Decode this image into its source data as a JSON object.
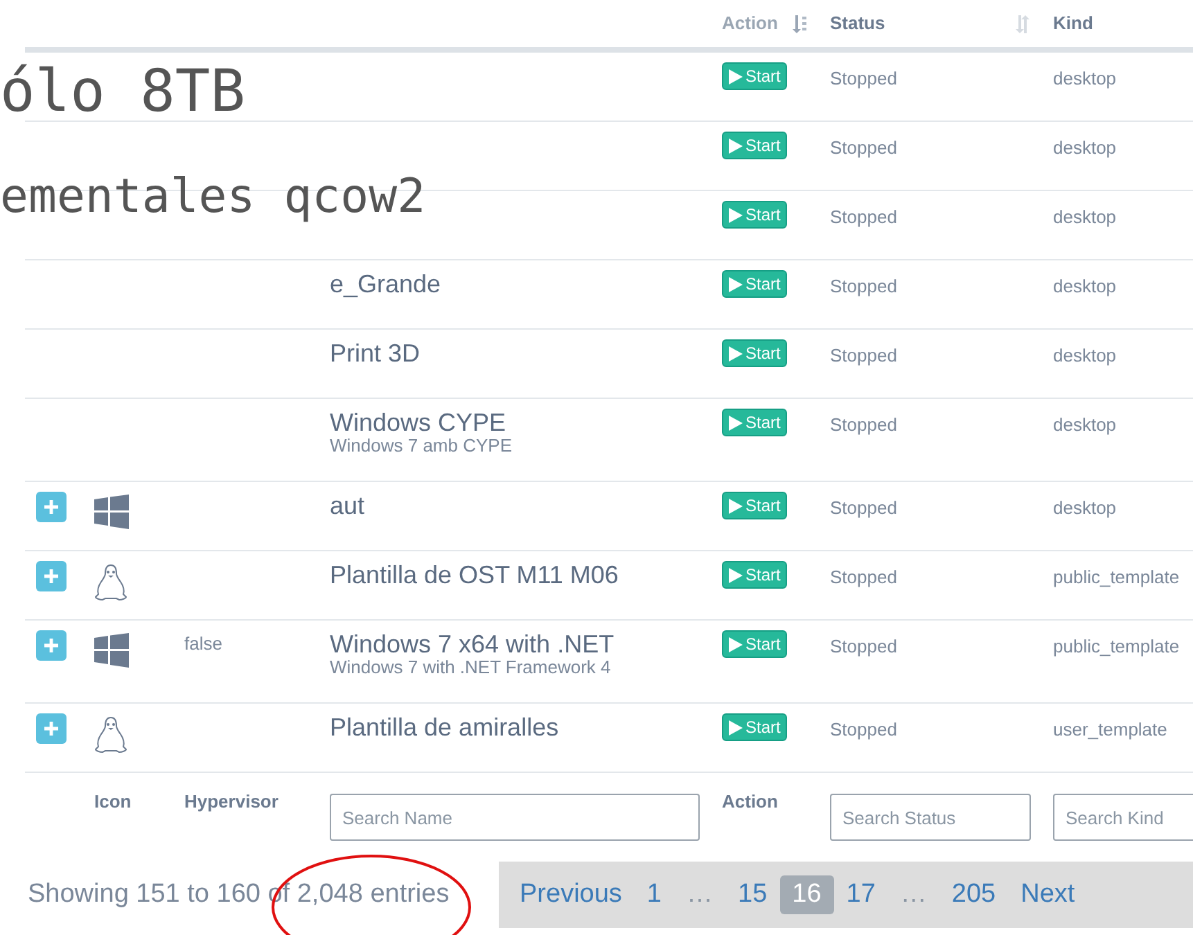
{
  "headings": [
    "ólo 8TB",
    "ementales qcow2"
  ],
  "columns": [
    "Action",
    "Status",
    "Kind"
  ],
  "rows": [
    {
      "kind": "plain",
      "action": "Start",
      "status": "Stopped",
      "type": "desktop"
    },
    {
      "kind": "plain",
      "action": "Start",
      "status": "Stopped",
      "type": "desktop"
    },
    {
      "kind": "plain",
      "action": "Start",
      "status": "Stopped",
      "type": "desktop"
    },
    {
      "kind": "plain",
      "name": "e_Grande",
      "action": "Start",
      "status": "Stopped",
      "type": "desktop"
    },
    {
      "kind": "plain",
      "name": "Print 3D",
      "action": "Start",
      "status": "Stopped",
      "type": "desktop"
    },
    {
      "kind": "plain",
      "name": "Windows CYPE",
      "description": "Windows 7 amb CYPE",
      "action": "Start",
      "status": "Stopped",
      "type": "desktop"
    },
    {
      "kind": "windows",
      "name": "aut",
      "action": "Start",
      "status": "Stopped",
      "type": "desktop"
    },
    {
      "kind": "linux",
      "name": "Plantilla de OST M11 M06",
      "action": "Start",
      "status": "Stopped",
      "type": "public_template"
    },
    {
      "kind": "windows",
      "hypervisor": "false",
      "name": "Windows 7 x64 with .NET",
      "description": "Windows 7 with .NET Framework 4",
      "action": "Start",
      "status": "Stopped",
      "type": "public_template"
    },
    {
      "kind": "linux",
      "name": "Plantilla de amiralles",
      "action": "Start",
      "status": "Stopped",
      "type": "user_template"
    }
  ],
  "footer": {
    "icon_label": "Icon",
    "hypervisor_label": "Hypervisor",
    "name_placeholder": "Search Name",
    "action_label": "Action",
    "status_placeholder": "Search Status",
    "kind_placeholder": "Search Kind"
  },
  "info": "Showing 151 to 160 of 2,048 entries",
  "pagination": [
    {
      "label": "Previous",
      "kind": "link",
      "selected": false
    },
    {
      "label": "1",
      "kind": "link",
      "selected": false
    },
    {
      "label": "…",
      "kind": "ellipsis",
      "selected": false
    },
    {
      "label": "15",
      "kind": "link",
      "selected": false
    },
    {
      "label": "16",
      "kind": "link",
      "selected": true
    },
    {
      "label": "17",
      "kind": "link",
      "selected": false
    },
    {
      "label": "…",
      "kind": "ellipsis",
      "selected": false
    },
    {
      "label": "205",
      "kind": "link",
      "selected": false
    },
    {
      "label": "Next",
      "kind": "link",
      "selected": false
    }
  ]
}
